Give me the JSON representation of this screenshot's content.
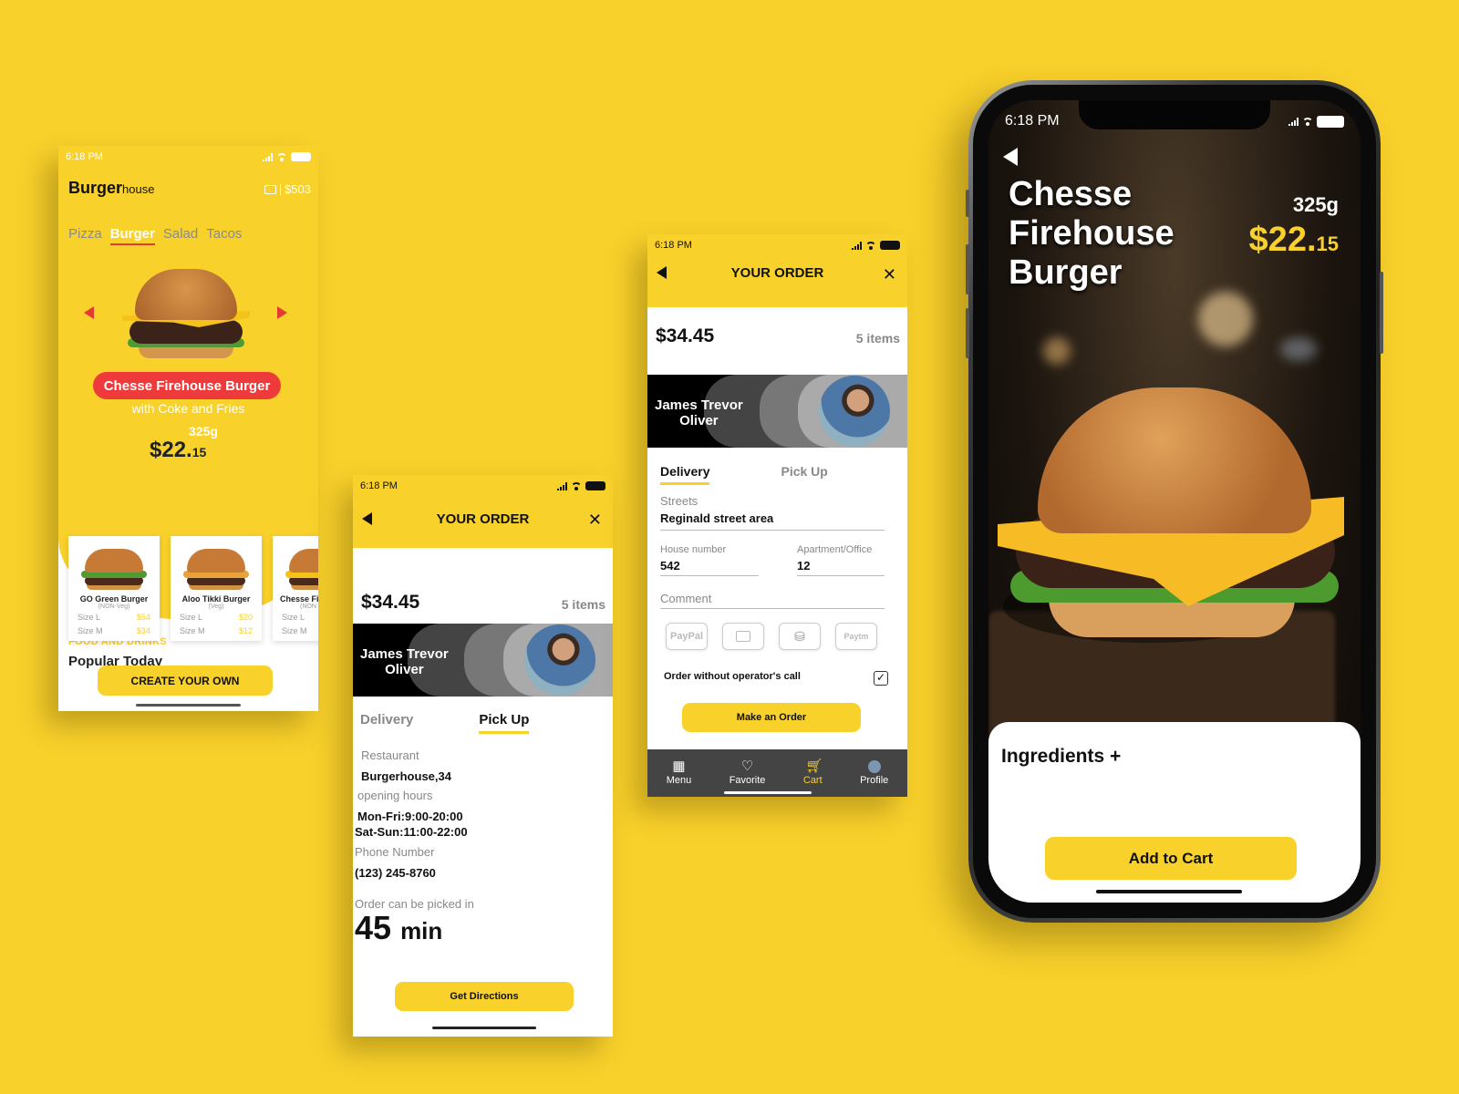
{
  "status_bar": {
    "time": "6:18 PM"
  },
  "colors": {
    "brand_yellow": "#f9d12b",
    "accent_red": "#ee3a3a",
    "nav_dark": "#444444"
  },
  "home_screen": {
    "brand_bold": "Burger",
    "brand_light": "house",
    "wallet_icon": "wallet-icon",
    "wallet_balance": "$503",
    "categories": [
      {
        "label": "Pizza",
        "active": false
      },
      {
        "label": "Burger",
        "active": true
      },
      {
        "label": "Salad",
        "active": false
      },
      {
        "label": "Tacos",
        "active": false
      }
    ],
    "featured": {
      "name": "Chesse Firehouse Burger",
      "subtitle": "with Coke and Fries",
      "weight": "325g",
      "price_main": "$22.",
      "price_cents": "15"
    },
    "section_kicker": "FOOD AND DRINKS",
    "section_title": "Popular Today",
    "popular": [
      {
        "name": "GO Green Burger",
        "type": "(NON-Veg)",
        "sizes": [
          {
            "label": "Size L",
            "price": "$54"
          },
          {
            "label": "Size M",
            "price": "$34"
          }
        ]
      },
      {
        "name": "Aloo Tikki Burger",
        "type": "(Veg)",
        "sizes": [
          {
            "label": "Size L",
            "price": "$20"
          },
          {
            "label": "Size M",
            "price": "$12"
          }
        ]
      },
      {
        "name": "Chesse Fi",
        "type": "(NON",
        "sizes": [
          {
            "label": "Size L",
            "price": ""
          },
          {
            "label": "Size M",
            "price": ""
          }
        ]
      }
    ],
    "cta": "CREATE YOUR OWN"
  },
  "order_common": {
    "title": "YOUR ORDER",
    "total": "$34.45",
    "item_count": "5 items",
    "user_name_line1": "James Trevor",
    "user_name_line2": "Oliver",
    "tab_delivery": "Delivery",
    "tab_pickup": "Pick Up"
  },
  "pickup_screen": {
    "active_tab": "Pick Up",
    "restaurant_label": "Restaurant",
    "restaurant_value": "Burgerhouse,34",
    "hours_label": "opening hours",
    "hours_weekday": "Mon-Fri:9:00-20:00",
    "hours_weekend": "Sat-Sun:11:00-22:00",
    "phone_label": "Phone Number",
    "phone_value": "(123) 245-8760",
    "pickup_label": "Order can be picked in",
    "pickup_number": "45",
    "pickup_unit": "min",
    "button": "Get Directions"
  },
  "delivery_screen": {
    "active_tab": "Delivery",
    "streets_label": "Streets",
    "streets_value": "Reginald street area",
    "house_label": "House number",
    "house_value": "542",
    "apt_label": "Apartment/Office",
    "apt_value": "12",
    "comment_label": "Comment",
    "comment_value": "",
    "payment_methods": [
      "PayPal",
      "wallet",
      "cash",
      "Paytm"
    ],
    "option_label": "Order without operator's call",
    "option_checked": true,
    "button": "Make an Order",
    "nav": [
      {
        "label": "Menu",
        "icon": "menu-icon",
        "active": false
      },
      {
        "label": "Favorite",
        "icon": "heart-icon",
        "active": false
      },
      {
        "label": "Cart",
        "icon": "cart-icon",
        "active": true
      },
      {
        "label": "Profile",
        "icon": "avatar-icon",
        "active": false
      }
    ]
  },
  "detail_screen": {
    "title_lines": [
      "Chesse",
      "Firehouse",
      "Burger"
    ],
    "weight": "325g",
    "price_main": "$22.",
    "price_cents": "15",
    "ingredients_label": "Ingredients +",
    "button": "Add to Cart"
  }
}
